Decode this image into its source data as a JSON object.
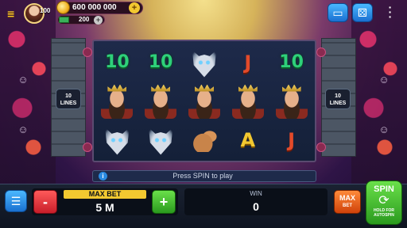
{
  "player": {
    "level": "100",
    "coins": "600 000 000",
    "coins_plus": "+",
    "cash": "200",
    "cash_plus": "+"
  },
  "top_buttons": {
    "video_icon": "tv-icon",
    "dice_icon": "dice-icon",
    "more_icon": "more-vertical-icon"
  },
  "reels": {
    "lines_left": "10\nLINES",
    "lines_left_num": "10",
    "lines_left_word": "LINES",
    "lines_right_num": "10",
    "lines_right_word": "LINES",
    "grid": [
      [
        "10",
        "10",
        "wolf",
        "J",
        "10"
      ],
      [
        "king",
        "king",
        "king",
        "king",
        "king"
      ],
      [
        "wolf",
        "wolf",
        "rabbit",
        "A",
        "J"
      ]
    ]
  },
  "info": {
    "message": "Press SPIN to play"
  },
  "bet": {
    "label": "MAX BET",
    "value": "5 M",
    "minus": "-",
    "plus": "+"
  },
  "win": {
    "label": "WIN",
    "value": "0"
  },
  "maxbet_button": {
    "line1": "MAX",
    "line2": "BET"
  },
  "spin_button": {
    "label": "SPIN",
    "hint_line1": "HOLD FOR",
    "hint_line2": "AUTOSPIN"
  },
  "colors": {
    "gold": "#f2c830",
    "green_button": "#3ab82a",
    "red_button": "#d8283a",
    "blue_button": "#2a8ae0",
    "orange_button": "#e85a14"
  }
}
